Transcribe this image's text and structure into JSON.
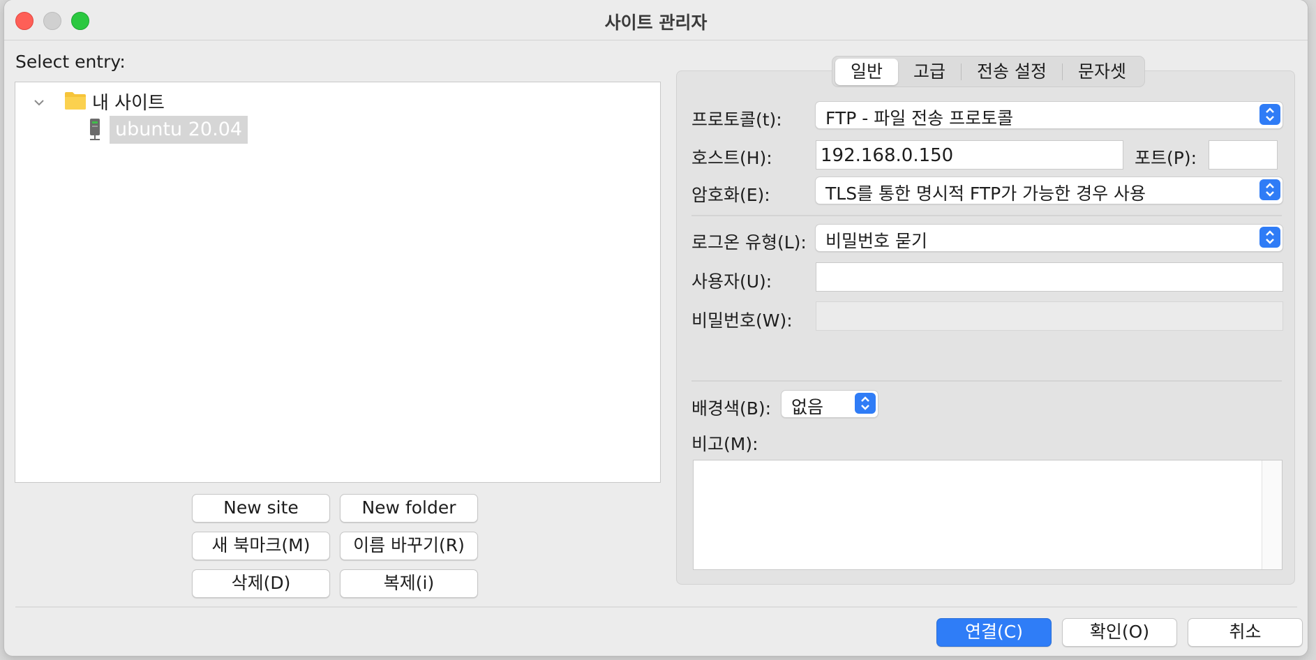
{
  "window": {
    "title": "사이트 관리자"
  },
  "left": {
    "select_label": "Select entry:",
    "tree": {
      "root_label": "내 사이트",
      "site_label": "ubuntu 20.04"
    },
    "buttons": {
      "new_site": "New site",
      "new_folder": "New folder",
      "new_bookmark": "새 북마크(M)",
      "rename": "이름 바꾸기(R)",
      "delete": "삭제(D)",
      "duplicate": "복제(i)"
    }
  },
  "tabs": [
    "일반",
    "고급",
    "전송 설정",
    "문자셋"
  ],
  "general": {
    "protocol_label": "프로토콜(t):",
    "protocol_value": "FTP - 파일 전송 프로토콜",
    "host_label": "호스트(H):",
    "host_value": "192.168.0.150",
    "port_label": "포트(P):",
    "port_value": "",
    "encryption_label": "암호화(E):",
    "encryption_value": "TLS를 통한 명시적 FTP가 가능한 경우 사용",
    "logon_label": "로그온 유형(L):",
    "logon_value": "비밀번호 묻기",
    "user_label": "사용자(U):",
    "user_value": "",
    "password_label": "비밀번호(W):",
    "password_value": "",
    "bgcolor_label": "배경색(B):",
    "bgcolor_value": "없음",
    "comments_label": "비고(M):",
    "comments_value": ""
  },
  "footer": {
    "connect": "연결(C)",
    "ok": "확인(O)",
    "cancel": "취소"
  },
  "colors": {
    "accent": "#2f7df7",
    "close": "#fe5f57",
    "zoom": "#2bc840"
  }
}
